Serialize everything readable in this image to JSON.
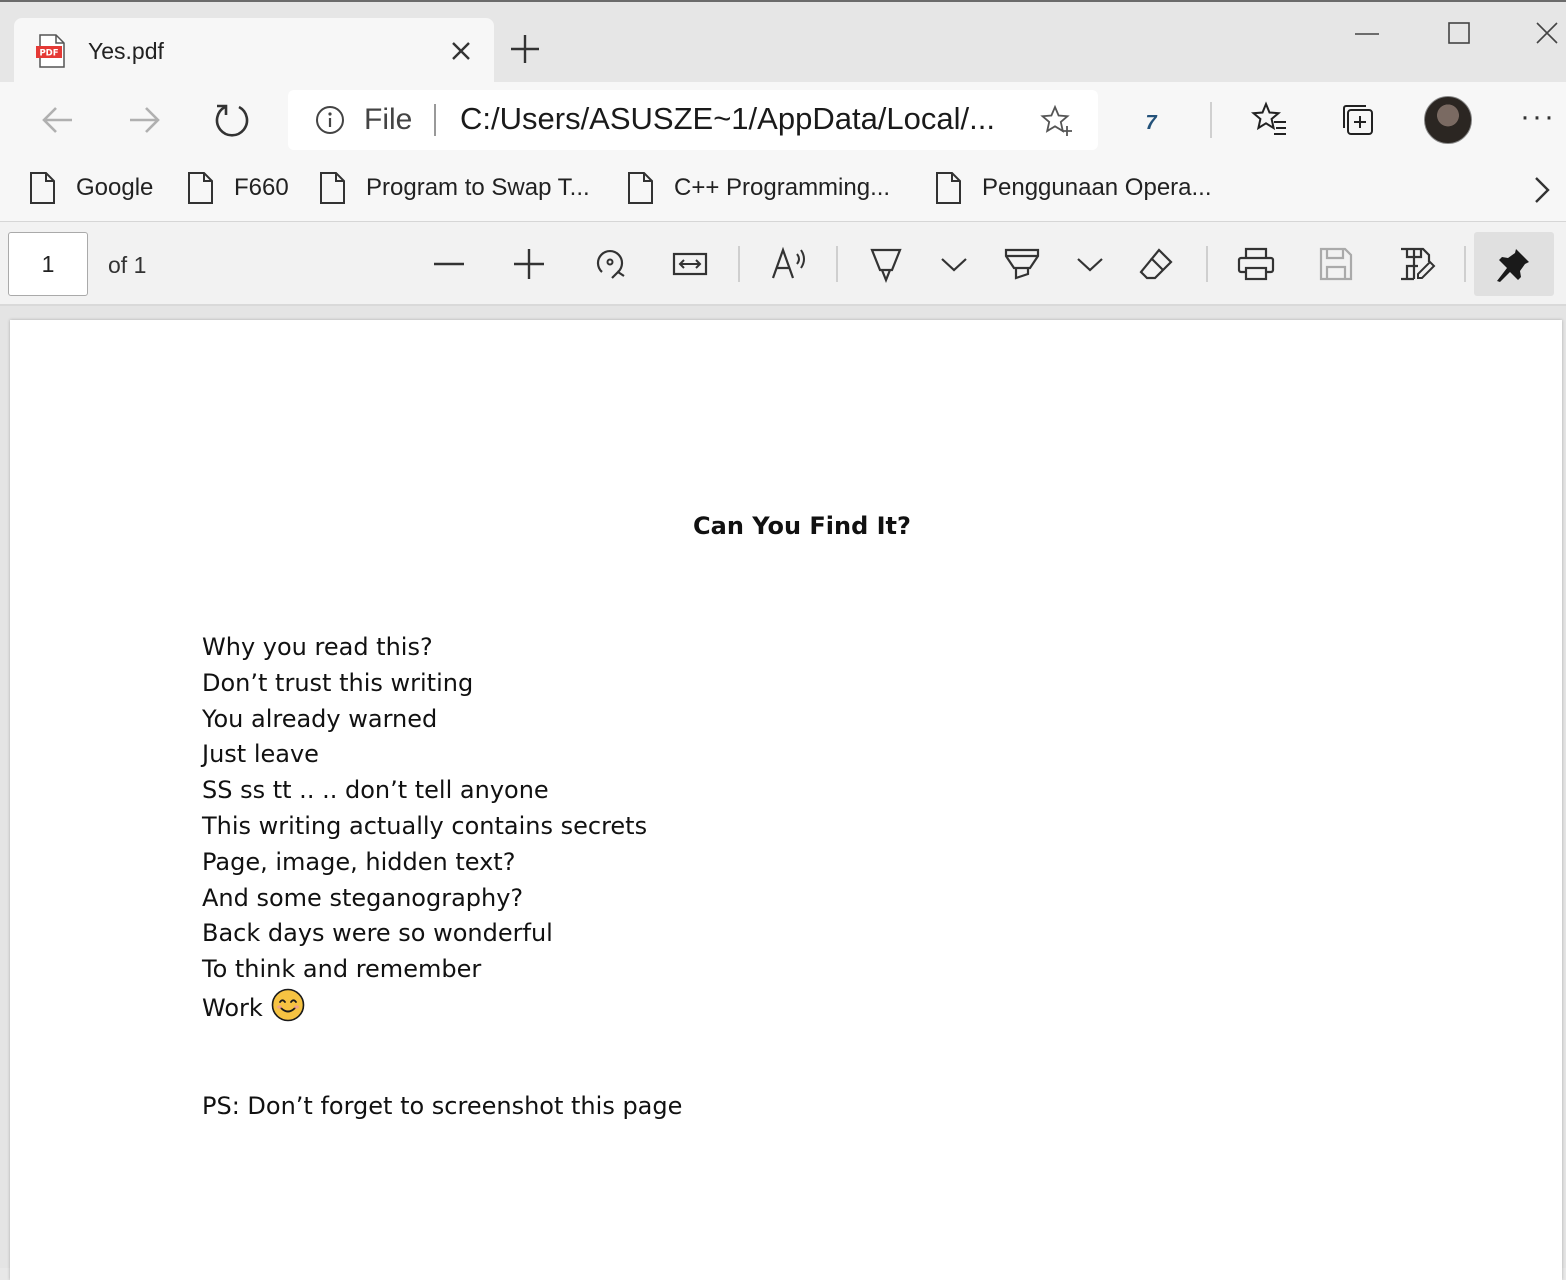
{
  "tab": {
    "title": "Yes.pdf",
    "pdf_badge": "PDF"
  },
  "address": {
    "scheme": "File",
    "url": "C:/Users/ASUSZE~1/AppData/Local/..."
  },
  "extension_label": "7",
  "bookmarks": [
    {
      "label": "Google"
    },
    {
      "label": "F660"
    },
    {
      "label": "Program to Swap T..."
    },
    {
      "label": "C++ Programming..."
    },
    {
      "label": "Penggunaan Opera..."
    }
  ],
  "pdf_toolbar": {
    "page_number": "1",
    "page_total": "of 1"
  },
  "document": {
    "title": "Can You Find It?",
    "lines": [
      "Why you read this?",
      "Don’t trust this writing",
      "You already warned",
      "Just leave",
      "SS ss tt .. .. don’t tell anyone",
      "This writing actually contains secrets",
      "Page, image, hidden text?",
      "And some steganography?",
      "Back days were so wonderful",
      "To think and remember",
      "Work"
    ],
    "last_line_emoji": "smiling-face-emoji",
    "postscript": "PS: Don’t forget to screenshot this page"
  },
  "colors": {
    "pdf_icon_red": "#e53935",
    "emoji_yellow": "#f6c342",
    "extension_blue": "#24527a"
  }
}
